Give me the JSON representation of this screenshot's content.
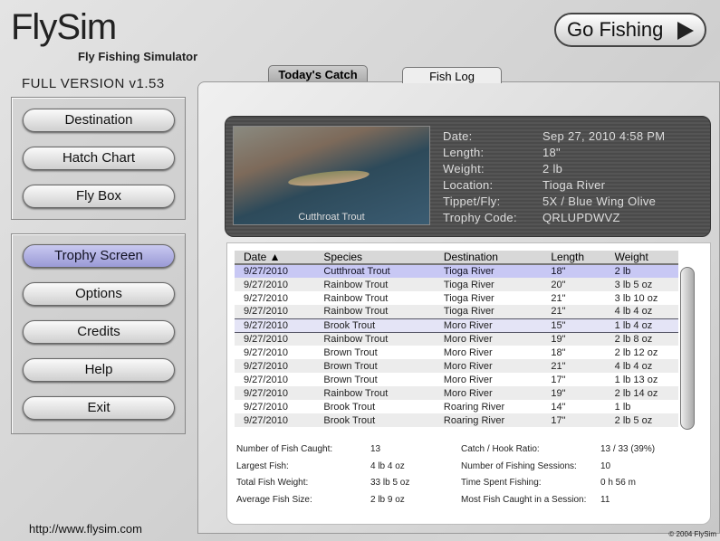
{
  "app": {
    "logo": "FlySim",
    "subtitle": "Fly Fishing Simulator",
    "version": "FULL VERSION v1.53",
    "url": "http://www.flysim.com",
    "copyright": "© 2004 FlySim"
  },
  "nav_top": [
    {
      "label": "Destination"
    },
    {
      "label": "Hatch Chart"
    },
    {
      "label": "Fly Box"
    }
  ],
  "nav_bottom": [
    {
      "label": "Trophy Screen",
      "active": true
    },
    {
      "label": "Options"
    },
    {
      "label": "Credits"
    },
    {
      "label": "Help"
    },
    {
      "label": "Exit"
    }
  ],
  "go_fishing": "Go Fishing",
  "tabs": [
    {
      "label": "Today's Catch"
    },
    {
      "label": "Fish Log",
      "active": true
    }
  ],
  "selected": {
    "caption": "Cutthroat Trout",
    "labels": [
      "Date:",
      "Length:",
      "Weight:",
      "Location:",
      "Tippet/Fly:",
      "Trophy Code:"
    ],
    "values": [
      "Sep 27, 2010  4:58 PM",
      "18\"",
      "2 lb",
      "Tioga River",
      "5X / Blue Wing Olive",
      "QRLUPDWVZ"
    ]
  },
  "table": {
    "columns": [
      "Date ▲",
      "Species",
      "Destination",
      "Length",
      "Weight"
    ],
    "rows": [
      [
        "9/27/2010",
        "Cutthroat Trout",
        "Tioga River",
        "18\"",
        "2 lb"
      ],
      [
        "9/27/2010",
        "Rainbow Trout",
        "Tioga River",
        "20\"",
        "3 lb 5 oz"
      ],
      [
        "9/27/2010",
        "Rainbow Trout",
        "Tioga River",
        "21\"",
        "3 lb 10 oz"
      ],
      [
        "9/27/2010",
        "Rainbow Trout",
        "Tioga River",
        "21\"",
        "4 lb 4 oz"
      ],
      [
        "9/27/2010",
        "Brook Trout",
        "Moro River",
        "15\"",
        "1 lb 4 oz"
      ],
      [
        "9/27/2010",
        "Rainbow Trout",
        "Moro River",
        "19\"",
        "2 lb 8 oz"
      ],
      [
        "9/27/2010",
        "Brown Trout",
        "Moro River",
        "18\"",
        "2 lb 12 oz"
      ],
      [
        "9/27/2010",
        "Brown Trout",
        "Moro River",
        "21\"",
        "4 lb 4 oz"
      ],
      [
        "9/27/2010",
        "Brown Trout",
        "Moro River",
        "17\"",
        "1 lb 13 oz"
      ],
      [
        "9/27/2010",
        "Rainbow Trout",
        "Moro River",
        "19\"",
        "2 lb 14 oz"
      ],
      [
        "9/27/2010",
        "Brook Trout",
        "Roaring River",
        "14\"",
        "1 lb"
      ],
      [
        "9/27/2010",
        "Brook Trout",
        "Roaring River",
        "17\"",
        "2 lb 5 oz"
      ]
    ]
  },
  "stats": [
    [
      "Number of Fish Caught:",
      "13",
      "Catch / Hook Ratio:",
      "13 / 33 (39%)"
    ],
    [
      "Largest Fish:",
      "4 lb 4 oz",
      "Number of Fishing Sessions:",
      "10"
    ],
    [
      "Total Fish Weight:",
      "33 lb 5 oz",
      "Time Spent Fishing:",
      "0 h 56 m"
    ],
    [
      "Average Fish Size:",
      "2 lb 9 oz",
      "Most Fish Caught in a Session:",
      "11"
    ]
  ]
}
